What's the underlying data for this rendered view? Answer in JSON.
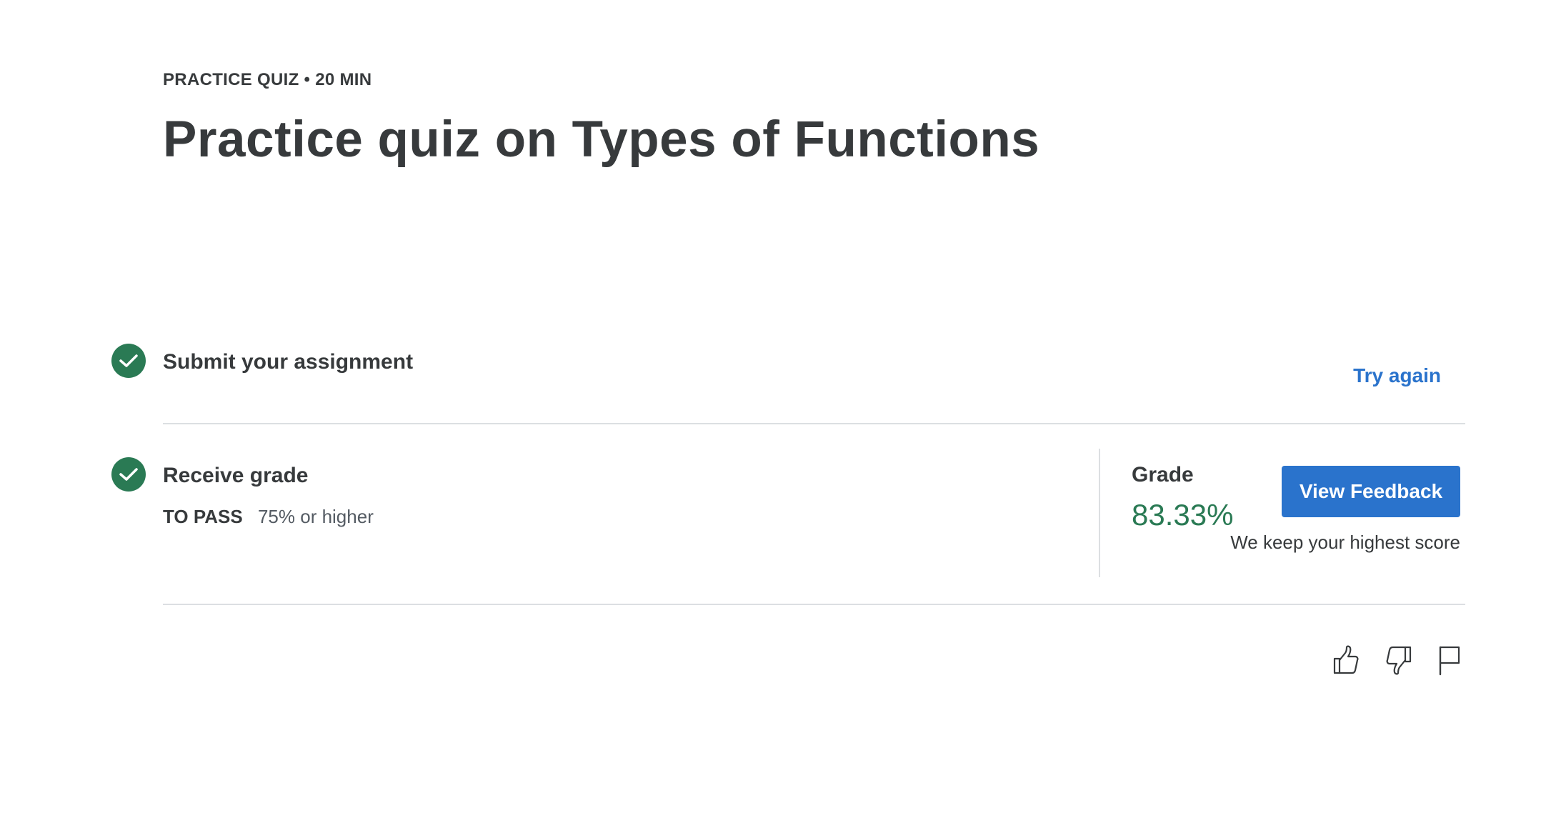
{
  "header": {
    "eyebrow": "PRACTICE QUIZ • 20 MIN",
    "title": "Practice quiz on Types of Functions"
  },
  "steps": {
    "submit": {
      "title": "Submit your assignment",
      "action_label": "Try again"
    },
    "grade": {
      "title": "Receive grade",
      "pass_label": "TO PASS",
      "pass_value": "75% or higher",
      "grade_label": "Grade",
      "grade_value": "83.33%",
      "feedback_button": "View Feedback",
      "note": "We keep your highest score"
    }
  },
  "feedback_icons": [
    "thumbs-up-icon",
    "thumbs-down-icon",
    "flag-icon"
  ],
  "colors": {
    "success": "#2a7a54",
    "primary": "#2a73cc",
    "text": "#373a3c",
    "divider": "#dcdfe2"
  }
}
